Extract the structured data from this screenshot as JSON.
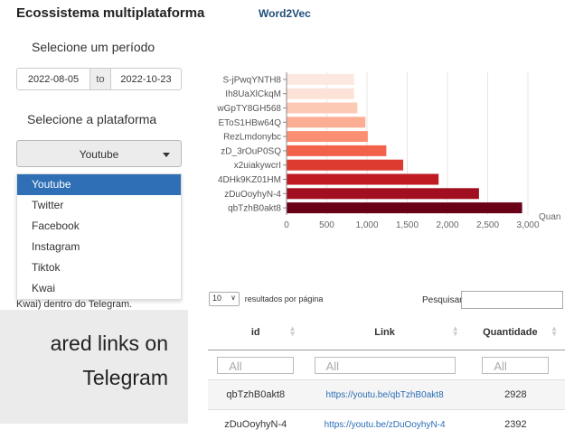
{
  "header": {
    "title": "Ecossistema multiplataforma",
    "tab": "Word2Vec"
  },
  "sidebar": {
    "period_label": "Selecione um período",
    "date_start": "2022-08-05",
    "date_sep": "to",
    "date_end": "2022-10-23",
    "platform_label": "Selecione a plataforma",
    "platform_selected": "Youtube",
    "options": [
      "Youtube",
      "Twitter",
      "Facebook",
      "Instagram",
      "Tiktok",
      "Kwai"
    ],
    "under_text": "Kwai) dentro do Telegram."
  },
  "overlay": {
    "line1": "ared links on",
    "line2": "Telegram"
  },
  "chart_data": {
    "type": "bar",
    "orientation": "horizontal",
    "categories": [
      "S-jPwqYNTH8",
      "Ih8UaXlCkqM",
      "wGpTY8GH568",
      "EToS1HBw64Q",
      "RezLmdonybc",
      "zD_3rOuP0SQ",
      "x2uiakywcrI",
      "4DHk9KZ01HM",
      "zDuOoyhyN-4",
      "qbTzhB0akt8"
    ],
    "values": [
      840,
      840,
      880,
      980,
      1010,
      1240,
      1450,
      1890,
      2392,
      2928
    ],
    "xlim": [
      0,
      3000
    ],
    "xticks": [
      "0",
      "500",
      "1,000",
      "1,500",
      "2,000",
      "2,500",
      "3,000"
    ],
    "xlabel": "Quan",
    "colors": [
      "#fde8e0",
      "#fde2d7",
      "#fcc9b4",
      "#fcae94",
      "#fb8f73",
      "#f2624a",
      "#dd3b2f",
      "#c01b22",
      "#a10e1f",
      "#6a0017"
    ]
  },
  "table": {
    "length_value": "10",
    "length_label": "resultados por página",
    "search_label": "Pesquisar",
    "columns": [
      "id",
      "Link",
      "Quantidade"
    ],
    "filter_placeholder": "All",
    "rows": [
      {
        "id": "qbTzhB0akt8",
        "link": "https://youtu.be/qbTzhB0akt8",
        "qty": "2928"
      },
      {
        "id": "zDuOoyhyN-4",
        "link": "https://youtu.be/zDuOoyhyN-4",
        "qty": "2392"
      }
    ]
  }
}
